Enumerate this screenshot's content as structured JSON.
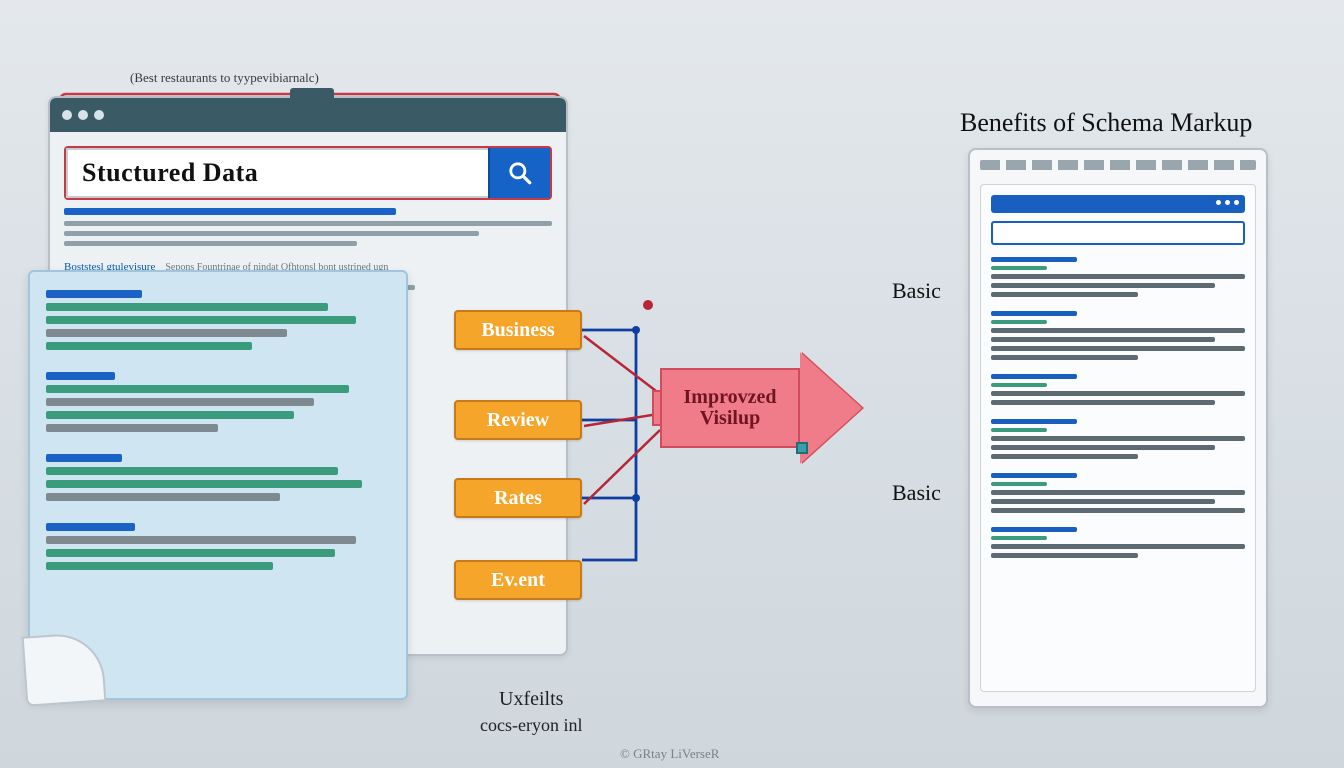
{
  "top_caption": "(Best restaurants to tyypevibiarnalc)",
  "search": {
    "query": "Stuctured Data",
    "link_text": "Boststesl gtulevisure",
    "link_sub": "Sepons Fountrinae of nindat Ofhtonsl bont ustrined ugn"
  },
  "schema_tags": {
    "business": "Business",
    "review": "Review",
    "rates": "Rates",
    "event": "Ev.ent"
  },
  "improved": {
    "line1": "Improvzed",
    "line2": "Visilup"
  },
  "right_title": "Benefits of Schema Markup",
  "labels": {
    "basic1": "Basic",
    "basic2": "Basic"
  },
  "bottom": {
    "a": "Uxfeilts",
    "b": "cocs-eryon inl"
  },
  "credit": "© GRtay LiVerseR"
}
